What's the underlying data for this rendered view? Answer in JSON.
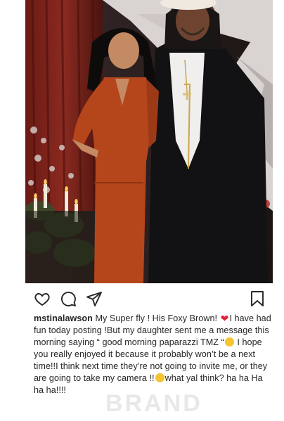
{
  "post": {
    "username": "mstinalawson",
    "caption_parts": [
      " My Super fly ! His Foxy Brown! ",
      "I have had fun today posting !But my daughter sent me a message this morning saying “ good morning paparazzi TMZ “",
      " I hope you really enjoyed it because it probably won’t be a next time!!I think next time they’re not going to invite me, or  they are going to take my camera !!",
      "what yal think?  ha ha Ha ha ha!!!!"
    ],
    "emojis": [
      "heart-red-emoji",
      "laughing-emoji",
      "grimacing-emoji"
    ],
    "watermark": "BRAND"
  },
  "actions": {
    "icons": [
      "heart-icon",
      "comment-icon",
      "share-icon",
      "bookmark-icon"
    ]
  },
  "colors": {
    "text": "#262626",
    "heart_emoji": "#e0243b",
    "dress": "#b5461c"
  }
}
